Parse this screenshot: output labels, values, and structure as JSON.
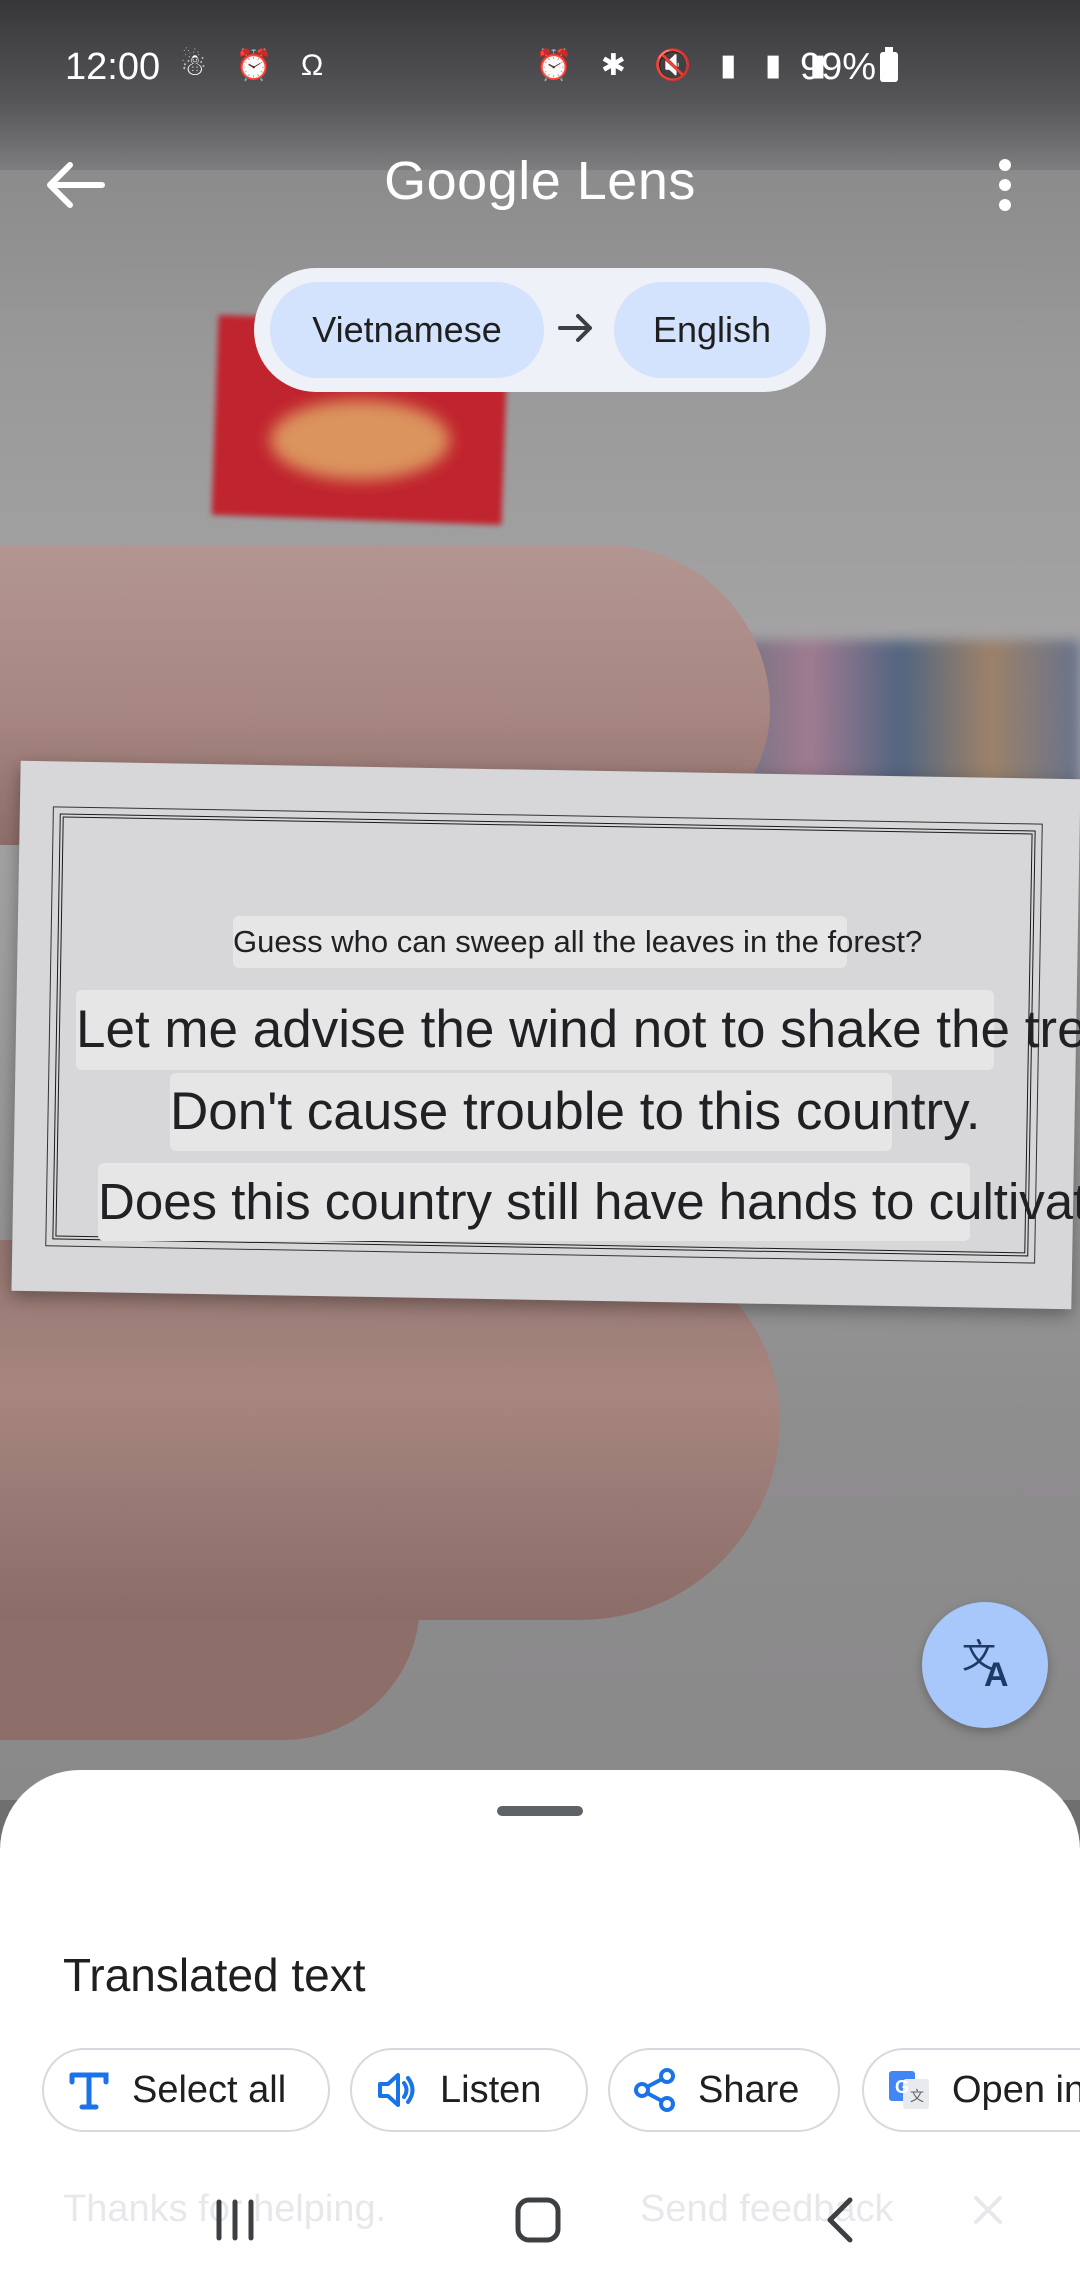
{
  "status_bar": {
    "time": "12:00",
    "left_icons": "☃ ⏰ Ω",
    "right_icons": "⏰ ✱ 🔇 ▮ ▮ ▮",
    "battery": "99%"
  },
  "app_bar": {
    "title": "Google Lens",
    "source_language": "Vietnamese",
    "target_language": "English"
  },
  "overlays": {
    "line1": "Guess who can sweep all the leaves in the forest?",
    "line2": "Let me advise the wind not to shake the tree",
    "line3": "Don't cause trouble to this country.",
    "line4": "Does this country still have hands to cultivate?"
  },
  "sheet": {
    "title": "Translated text",
    "actions": [
      {
        "label": "Select all",
        "icon": "text-select-icon"
      },
      {
        "label": "Listen",
        "icon": "speaker-icon"
      },
      {
        "label": "Share",
        "icon": "share-icon"
      },
      {
        "label": "Open in",
        "icon": "google-translate-icon"
      }
    ],
    "feedback_left": "Thanks for helping.",
    "feedback_right": "Send feedback"
  },
  "colors": {
    "chip": "#d3e3fd",
    "pill": "#eef1f8",
    "fab": "#a8c7fa",
    "accent_icon": "#1a73e8"
  }
}
